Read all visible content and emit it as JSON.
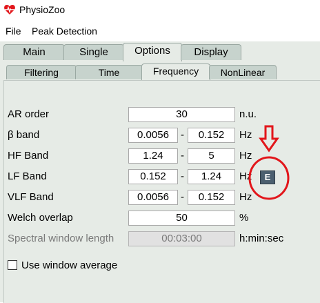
{
  "window": {
    "title": "PhysioZoo"
  },
  "menu": {
    "file": "File",
    "peak_detection": "Peak Detection"
  },
  "tabs": {
    "main": "Main",
    "single": "Single",
    "options": "Options",
    "display": "Display"
  },
  "subtabs": {
    "filtering": "Filtering",
    "time": "Time",
    "frequency": "Frequency",
    "nonlinear": "NonLinear"
  },
  "params": {
    "ar_order": {
      "label": "AR order",
      "value": "30",
      "unit": "n.u."
    },
    "beta_band": {
      "label": "β band",
      "low": "0.0056",
      "high": "0.152",
      "unit": "Hz"
    },
    "hf_band": {
      "label": "HF Band",
      "low": "1.24",
      "high": "5",
      "unit": "Hz"
    },
    "lf_band": {
      "label": "LF Band",
      "low": "0.152",
      "high": "1.24",
      "unit": "Hz"
    },
    "vlf_band": {
      "label": "VLF Band",
      "low": "0.0056",
      "high": "0.152",
      "unit": "Hz"
    },
    "welch_overlap": {
      "label": "Welch overlap",
      "value": "50",
      "unit": "%"
    },
    "spectral_window": {
      "label": "Spectral window length",
      "value": "00:03:00",
      "unit": "h:min:sec"
    }
  },
  "dash": "-",
  "e_button": "E",
  "use_window_average": "Use window average",
  "colors": {
    "panel": "#e6ebe6",
    "tab": "#c7d3cd",
    "annotation": "#e2161b",
    "e_button": "#4b5f6f"
  }
}
